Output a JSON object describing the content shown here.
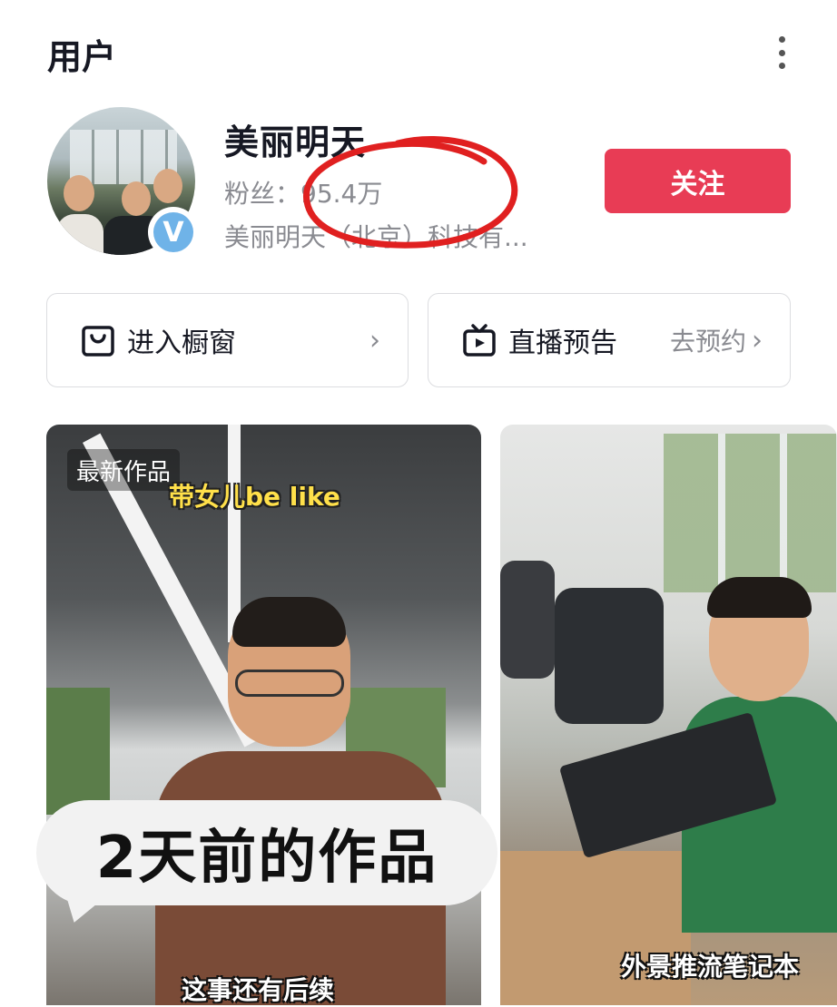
{
  "header": {
    "title": "用户"
  },
  "profile": {
    "nickname": "美丽明天",
    "fans_text": "粉丝：95.4万",
    "company": "美丽明天（北京）科技有...",
    "verified_mark": "V",
    "follow_label": "关注"
  },
  "actions": {
    "shop_label": "进入橱窗",
    "live_label": "直播预告",
    "live_sub": "去预约"
  },
  "videos": [
    {
      "badge": "最新作品",
      "caption_top": "带女儿be like",
      "bubble_text": "2天前的作品",
      "caption_bottom": "这事还有后续"
    },
    {
      "caption": "外景推流笔记本"
    }
  ],
  "colors": {
    "follow_bg": "#e83c55",
    "annotation": "#e02020"
  }
}
